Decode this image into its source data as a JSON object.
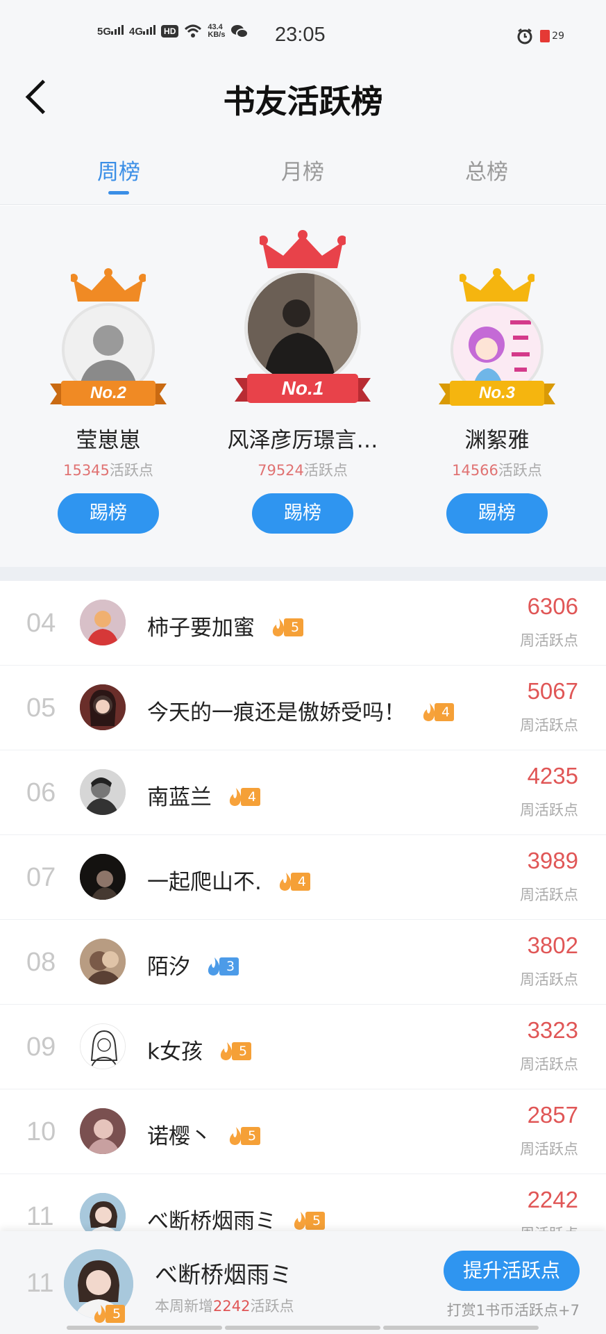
{
  "status_bar": {
    "net1": "5G",
    "net2": "4G",
    "hd": "HD",
    "speed_value": "43.4",
    "speed_unit": "KB/s",
    "time": "23:05",
    "battery": "29"
  },
  "header": {
    "title": "书友活跃榜"
  },
  "tabs": [
    {
      "label": "周榜",
      "active": true
    },
    {
      "label": "月榜",
      "active": false
    },
    {
      "label": "总榜",
      "active": false
    }
  ],
  "podium": [
    {
      "rank_badge": "No.2",
      "name": "莹崽崽",
      "points": "15345",
      "points_label": "活跃点",
      "button": "踢榜",
      "color": "#f08a24"
    },
    {
      "rank_badge": "No.1",
      "name": "风泽彦厉璟言…",
      "points": "79524",
      "points_label": "活跃点",
      "button": "踢榜",
      "color": "#e8424a"
    },
    {
      "rank_badge": "No.3",
      "name": "渊絮雅",
      "points": "14566",
      "points_label": "活跃点",
      "button": "踢榜",
      "color": "#f5b50f"
    }
  ],
  "list": [
    {
      "rank": "04",
      "name": "柿子要加蜜",
      "level": "5",
      "level_color": "orange",
      "value": "6306",
      "label": "周活跃点"
    },
    {
      "rank": "05",
      "name": "今天的一痕还是傲娇受吗！",
      "level": "4",
      "level_color": "orange",
      "value": "5067",
      "label": "周活跃点"
    },
    {
      "rank": "06",
      "name": "南蓝兰",
      "level": "4",
      "level_color": "orange",
      "value": "4235",
      "label": "周活跃点"
    },
    {
      "rank": "07",
      "name": "一起爬山不.",
      "level": "4",
      "level_color": "orange",
      "value": "3989",
      "label": "周活跃点"
    },
    {
      "rank": "08",
      "name": "陌汐",
      "level": "3",
      "level_color": "blue",
      "value": "3802",
      "label": "周活跃点"
    },
    {
      "rank": "09",
      "name": "k女孩",
      "level": "5",
      "level_color": "orange",
      "value": "3323",
      "label": "周活跃点"
    },
    {
      "rank": "10",
      "name": "诺樱丶",
      "level": "5",
      "level_color": "orange",
      "value": "2857",
      "label": "周活跃点"
    },
    {
      "rank": "11",
      "name": "べ断桥烟雨ミ",
      "level": "5",
      "level_color": "orange",
      "value": "2242",
      "label": "周活跃点"
    }
  ],
  "me": {
    "rank": "11",
    "name": "べ断桥烟雨ミ",
    "level": "5",
    "sub_prefix": "本周新增",
    "sub_value": "2242",
    "sub_suffix": "活跃点",
    "button": "提升活跃点",
    "tip": "打赏1书币活跃点+7"
  },
  "colors": {
    "accent": "#2f95f0",
    "points_red": "#e05656",
    "level_orange": "#f5a037",
    "level_blue": "#4c9be8"
  }
}
